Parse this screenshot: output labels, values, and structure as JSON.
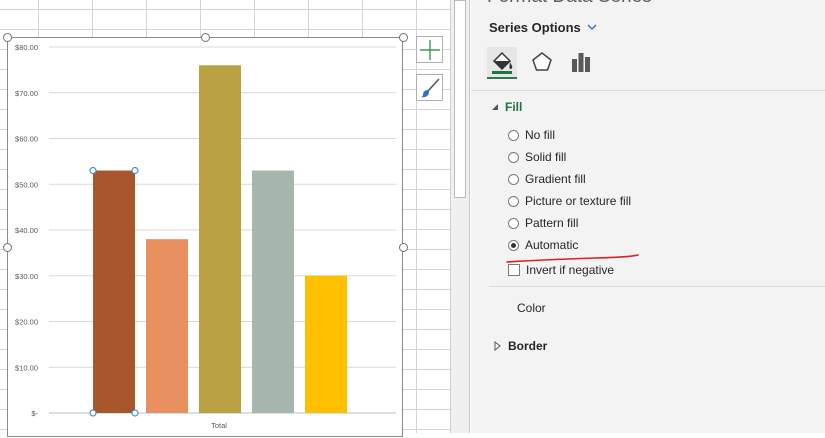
{
  "pane": {
    "title": "Format Data Series",
    "series_options_label": "Series Options",
    "tabs": [
      {
        "icon": "paint-bucket-icon",
        "name": "Fill & Line",
        "active": true
      },
      {
        "icon": "pentagon-icon",
        "name": "Effects",
        "active": false
      },
      {
        "icon": "bar-chart-icon",
        "name": "Series Options",
        "active": false
      }
    ],
    "fill": {
      "section_label": "Fill",
      "expanded": true,
      "options": [
        {
          "label": "No fill",
          "checked": false
        },
        {
          "label": "Solid fill",
          "checked": false
        },
        {
          "label": "Gradient fill",
          "checked": false
        },
        {
          "label": "Picture or texture fill",
          "checked": false
        },
        {
          "label": "Pattern fill",
          "checked": false
        },
        {
          "label": "Automatic",
          "checked": true
        }
      ],
      "invert_label": "Invert if negative",
      "invert_checked": false,
      "color_label": "Color"
    },
    "border": {
      "section_label": "Border",
      "expanded": false
    }
  },
  "chart_data": {
    "type": "bar",
    "categories": [
      "Total"
    ],
    "series": [
      {
        "values": [
          53
        ],
        "color": "#A9562C"
      },
      {
        "values": [
          38
        ],
        "color": "#E99061"
      },
      {
        "values": [
          76
        ],
        "color": "#BAA244"
      },
      {
        "values": [
          53
        ],
        "color": "#A5B6AC"
      },
      {
        "values": [
          30
        ],
        "color": "#FFC000"
      }
    ],
    "ylim": [
      0,
      80
    ],
    "ytick_labels": [
      "$-",
      "$10.00",
      "$20.00",
      "$30.00",
      "$40.00",
      "$50.00",
      "$60.00",
      "$70.00",
      "$80.00"
    ],
    "xlabel": "",
    "ylabel": "",
    "grid": true,
    "legend": "none",
    "selected_series_index": 0
  },
  "chart_buttons": [
    {
      "icon": "plus-icon",
      "name": "Chart Elements"
    },
    {
      "icon": "brush-icon",
      "name": "Chart Styles"
    }
  ],
  "annotation": {
    "color": "#E02020"
  }
}
